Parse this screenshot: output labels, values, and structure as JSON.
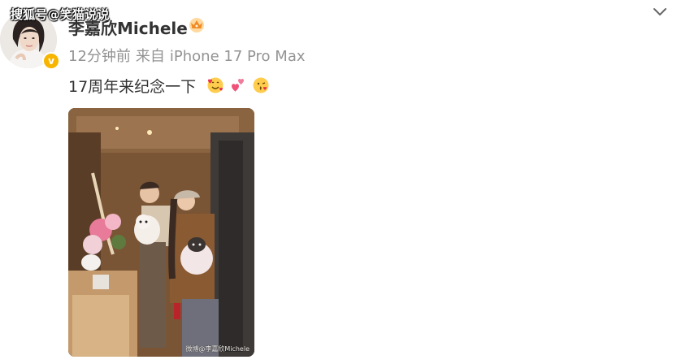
{
  "watermark": "搜狐号@笑猫说说",
  "post": {
    "username": "李嘉欣Michele",
    "time": "12分钟前",
    "source_prefix": "来自",
    "device": "iPhone 17 Pro Max",
    "content": "17周年来纪念一下",
    "photo_watermark": "微博@李嘉欣Michele"
  },
  "icons": {
    "verified": "verified-badge-icon",
    "vip": "vip-crown-icon",
    "menu": "chevron-down-icon",
    "emojis": [
      "hearts-face-emoji",
      "two-hearts-emoji",
      "kissing-face-emoji"
    ]
  },
  "colors": {
    "username": "#333333",
    "meta": "#939393",
    "verified_badge": "#f7b500"
  }
}
